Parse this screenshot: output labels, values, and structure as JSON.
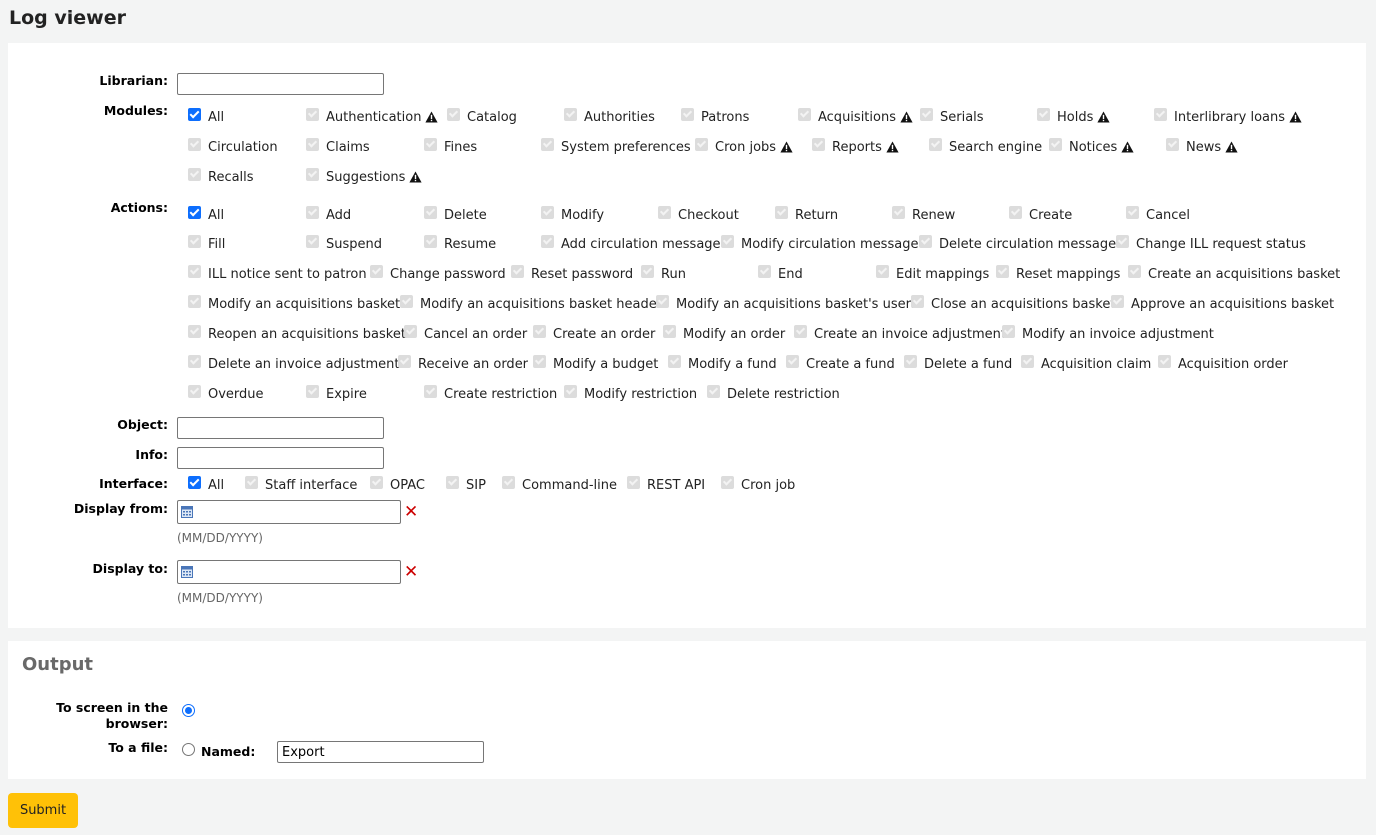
{
  "page": {
    "title": "Log viewer"
  },
  "filters": {
    "librarian": {
      "label": "Librarian:",
      "value": ""
    },
    "modules": {
      "label": "Modules:",
      "items": [
        {
          "label": "All",
          "checked": true,
          "warning": false
        },
        {
          "label": "Authentication",
          "checked": true,
          "warning": true
        },
        {
          "label": "Catalog",
          "checked": true,
          "warning": false
        },
        {
          "label": "Authorities",
          "checked": true,
          "warning": false
        },
        {
          "label": "Patrons",
          "checked": true,
          "warning": false
        },
        {
          "label": "Acquisitions",
          "checked": true,
          "warning": true
        },
        {
          "label": "Serials",
          "checked": true,
          "warning": false
        },
        {
          "label": "Holds",
          "checked": true,
          "warning": true
        },
        {
          "label": "Interlibrary loans",
          "checked": true,
          "warning": true
        },
        {
          "label": "Circulation",
          "checked": true,
          "warning": false
        },
        {
          "label": "Claims",
          "checked": true,
          "warning": false
        },
        {
          "label": "Fines",
          "checked": true,
          "warning": false
        },
        {
          "label": "System preferences",
          "checked": true,
          "warning": false
        },
        {
          "label": "Cron jobs",
          "checked": true,
          "warning": true
        },
        {
          "label": "Reports",
          "checked": true,
          "warning": true
        },
        {
          "label": "Search engine",
          "checked": true,
          "warning": false
        },
        {
          "label": "Notices",
          "checked": true,
          "warning": true
        },
        {
          "label": "News",
          "checked": true,
          "warning": true
        },
        {
          "label": "Recalls",
          "checked": true,
          "warning": false
        },
        {
          "label": "Suggestions",
          "checked": true,
          "warning": true
        }
      ]
    },
    "actions": {
      "label": "Actions:",
      "items": [
        "All",
        "Add",
        "Delete",
        "Modify",
        "Checkout",
        "Return",
        "Renew",
        "Create",
        "Cancel",
        "Fill",
        "Suspend",
        "Resume",
        "Add circulation message",
        "Modify circulation message",
        "Delete circulation message",
        "Change ILL request status",
        "ILL notice sent to patron",
        "Change password",
        "Reset password",
        "Run",
        "End",
        "Edit mappings",
        "Reset mappings",
        "Create an acquisitions basket",
        "Modify an acquisitions basket",
        "Modify an acquisitions basket header",
        "Modify an acquisitions basket's users",
        "Close an acquisitions basket",
        "Approve an acquisitions basket",
        "Reopen an acquisitions basket",
        "Cancel an order",
        "Create an order",
        "Modify an order",
        "Create an invoice adjustment",
        "Modify an invoice adjustment",
        "Delete an invoice adjustment",
        "Receive an order",
        "Modify a budget",
        "Modify a fund",
        "Create a fund",
        "Delete a fund",
        "Acquisition claim",
        "Acquisition order",
        "Overdue",
        "Expire",
        "Create restriction",
        "Modify restriction",
        "Delete restriction"
      ]
    },
    "object": {
      "label": "Object:",
      "value": ""
    },
    "info": {
      "label": "Info:",
      "value": ""
    },
    "interface": {
      "label": "Interface:",
      "items": [
        "All",
        "Staff interface",
        "OPAC",
        "SIP",
        "Command-line",
        "REST API",
        "Cron job"
      ]
    },
    "display_from": {
      "label": "Display from:",
      "value": "",
      "hint": "(MM/DD/YYYY)",
      "icon": "calendar-icon",
      "clear_icon": "close-icon"
    },
    "display_to": {
      "label": "Display to:",
      "value": "",
      "hint": "(MM/DD/YYYY)",
      "icon": "calendar-icon",
      "clear_icon": "close-icon"
    }
  },
  "output": {
    "title": "Output",
    "to_screen": {
      "label": "To screen in the browser:",
      "selected": true
    },
    "to_file": {
      "label": "To a file:",
      "selected": false,
      "named_label": "Named:",
      "named_value": "Export"
    }
  },
  "submit_label": "Submit",
  "colors": {
    "accent": "#0d6efd",
    "submit": "#ffc107",
    "clear": "#cc0000",
    "background": "#f3f4f4"
  }
}
